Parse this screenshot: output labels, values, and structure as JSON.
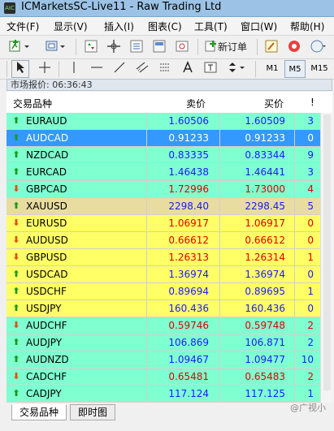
{
  "window": {
    "title": "ICMarketsSC-Live11 - Raw Trading Ltd",
    "icon_text": "AIC"
  },
  "menu": [
    "文件(F)",
    "显示(V)",
    "插入(I)",
    "图表(C)",
    "工具(T)",
    "窗口(W)",
    "帮助(H)"
  ],
  "toolbar": {
    "new_order_label": "新订单",
    "timeframes": [
      "M1",
      "M5",
      "M15"
    ],
    "active_timeframe": "M5"
  },
  "market_watch": {
    "header": "市场报价: 06:36:43",
    "columns": {
      "symbol": "交易品种",
      "bid": "卖价",
      "ask": "买价",
      "spread": "!"
    },
    "rows": [
      {
        "symbol": "EURAUD",
        "bid": "1.60506",
        "ask": "1.60509",
        "spread": "3",
        "dir": "up",
        "bg": "#80ffd0",
        "color": "#1a1aff",
        "sel": false
      },
      {
        "symbol": "AUDCAD",
        "bid": "0.91233",
        "ask": "0.91233",
        "spread": "0",
        "dir": "up",
        "bg": "#3399ff",
        "color": "#ffffff",
        "sel": true
      },
      {
        "symbol": "NZDCAD",
        "bid": "0.83335",
        "ask": "0.83344",
        "spread": "9",
        "dir": "up",
        "bg": "#80ffd0",
        "color": "#1a1aff",
        "sel": false
      },
      {
        "symbol": "EURCAD",
        "bid": "1.46438",
        "ask": "1.46441",
        "spread": "3",
        "dir": "up",
        "bg": "#80ffd0",
        "color": "#1a1aff",
        "sel": false
      },
      {
        "symbol": "GBPCAD",
        "bid": "1.72996",
        "ask": "1.73000",
        "spread": "4",
        "dir": "down",
        "bg": "#80ffd0",
        "color": "#e00000",
        "sel": false
      },
      {
        "symbol": "XAUUSD",
        "bid": "2298.40",
        "ask": "2298.45",
        "spread": "5",
        "dir": "up",
        "bg": "#e8dca0",
        "color": "#1a1aff",
        "sel": false
      },
      {
        "symbol": "EURUSD",
        "bid": "1.06917",
        "ask": "1.06917",
        "spread": "0",
        "dir": "down",
        "bg": "#ffff66",
        "color": "#e00000",
        "sel": false
      },
      {
        "symbol": "AUDUSD",
        "bid": "0.66612",
        "ask": "0.66612",
        "spread": "0",
        "dir": "down",
        "bg": "#ffff66",
        "color": "#e00000",
        "sel": false
      },
      {
        "symbol": "GBPUSD",
        "bid": "1.26313",
        "ask": "1.26314",
        "spread": "1",
        "dir": "down",
        "bg": "#ffff66",
        "color": "#e00000",
        "sel": false
      },
      {
        "symbol": "USDCAD",
        "bid": "1.36974",
        "ask": "1.36974",
        "spread": "0",
        "dir": "up",
        "bg": "#ffff66",
        "color": "#1a1aff",
        "sel": false
      },
      {
        "symbol": "USDCHF",
        "bid": "0.89694",
        "ask": "0.89695",
        "spread": "1",
        "dir": "up",
        "bg": "#ffff66",
        "color": "#1a1aff",
        "sel": false
      },
      {
        "symbol": "USDJPY",
        "bid": "160.436",
        "ask": "160.436",
        "spread": "0",
        "dir": "up",
        "bg": "#ffff66",
        "color": "#1a1aff",
        "sel": false
      },
      {
        "symbol": "AUDCHF",
        "bid": "0.59746",
        "ask": "0.59748",
        "spread": "2",
        "dir": "down",
        "bg": "#80ffd0",
        "color": "#e00000",
        "sel": false
      },
      {
        "symbol": "AUDJPY",
        "bid": "106.869",
        "ask": "106.871",
        "spread": "2",
        "dir": "up",
        "bg": "#80ffd0",
        "color": "#1a1aff",
        "sel": false
      },
      {
        "symbol": "AUDNZD",
        "bid": "1.09467",
        "ask": "1.09477",
        "spread": "10",
        "dir": "up",
        "bg": "#80ffd0",
        "color": "#1a1aff",
        "sel": false
      },
      {
        "symbol": "CADCHF",
        "bid": "0.65481",
        "ask": "0.65483",
        "spread": "2",
        "dir": "down",
        "bg": "#80ffd0",
        "color": "#e00000",
        "sel": false
      },
      {
        "symbol": "CADJPY",
        "bid": "117.124",
        "ask": "117.125",
        "spread": "1",
        "dir": "up",
        "bg": "#80ffd0",
        "color": "#1a1aff",
        "sel": false
      }
    ]
  },
  "tabs": [
    "交易品种",
    "即时图"
  ],
  "watermark": "@广视小"
}
